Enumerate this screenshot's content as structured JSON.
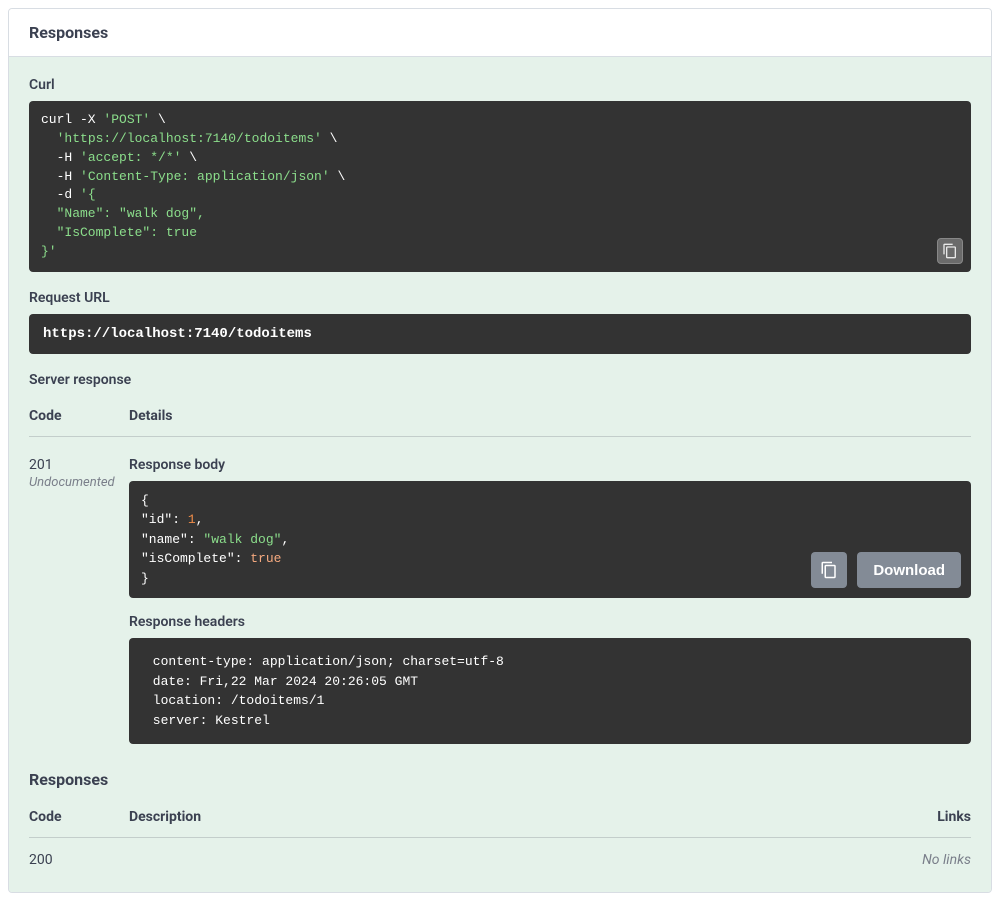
{
  "header": {
    "title": "Responses"
  },
  "curl": {
    "label": "Curl",
    "line1_a": "curl -X ",
    "line1_b": "'POST'",
    "line1_c": " \\",
    "line2_a": "  ",
    "line2_b": "'https://localhost:7140/todoitems'",
    "line2_c": " \\",
    "line3_a": "  -H ",
    "line3_b": "'accept: */*'",
    "line3_c": " \\",
    "line4_a": "  -H ",
    "line4_b": "'Content-Type: application/json'",
    "line4_c": " \\",
    "line5_a": "  -d ",
    "line5_b": "'{",
    "line6": "  \"Name\": \"walk dog\",",
    "line7": "  \"IsComplete\": true",
    "line8": "}'"
  },
  "request_url": {
    "label": "Request URL",
    "value": "https://localhost:7140/todoitems"
  },
  "server_response": {
    "label": "Server response",
    "code_header": "Code",
    "details_header": "Details",
    "code": "201",
    "undocumented": "Undocumented",
    "body_label": "Response body",
    "body": {
      "open": "{",
      "l1_key": "  \"id\"",
      "l1_colon": ": ",
      "l1_val": "1",
      "l1_comma": ",",
      "l2_key": "  \"name\"",
      "l2_colon": ": ",
      "l2_val": "\"walk dog\"",
      "l2_comma": ",",
      "l3_key": "  \"isComplete\"",
      "l3_colon": ": ",
      "l3_val": "true",
      "close": "}"
    },
    "download_label": "Download",
    "headers_label": "Response headers",
    "headers_text": " content-type: application/json; charset=utf-8 \n date: Fri,22 Mar 2024 20:26:05 GMT \n location: /todoitems/1 \n server: Kestrel "
  },
  "responses2": {
    "title": "Responses",
    "code_header": "Code",
    "desc_header": "Description",
    "links_header": "Links",
    "rows": [
      {
        "code": "200",
        "desc": "",
        "links": "No links"
      }
    ]
  }
}
